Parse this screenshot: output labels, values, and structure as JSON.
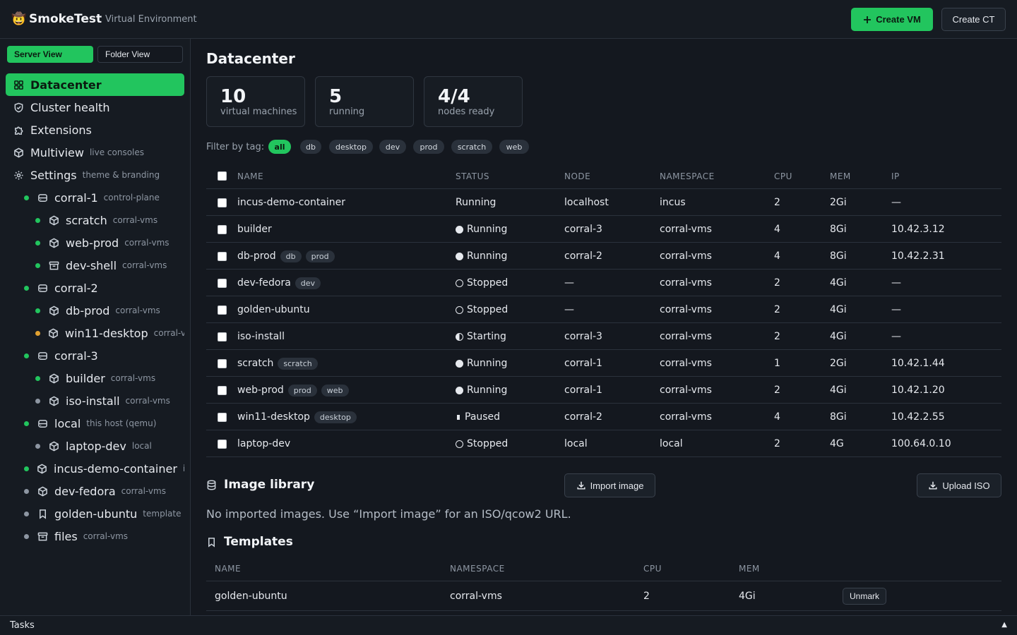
{
  "header": {
    "brand_emoji": "🤠",
    "brand_name": "SmokeTest",
    "brand_sub": "Virtual Environment",
    "create_vm_label": "Create VM",
    "create_ct_label": "Create CT"
  },
  "sidebar": {
    "server_view_label": "Server View",
    "folder_view_label": "Folder View",
    "items": [
      {
        "label": "Datacenter",
        "sub": "",
        "icon": "grid-icon"
      },
      {
        "label": "Cluster health",
        "sub": "",
        "icon": "shield-icon"
      },
      {
        "label": "Extensions",
        "sub": "",
        "icon": "puzzle-icon"
      },
      {
        "label": "Multiview",
        "sub": "live consoles",
        "icon": "cube-icon"
      },
      {
        "label": "Settings",
        "sub": "theme & branding",
        "icon": "gear-icon"
      },
      {
        "label": "corral-1",
        "sub": "control-plane",
        "icon": "server-icon",
        "status": "green"
      },
      {
        "label": "scratch",
        "sub": "corral-vms",
        "icon": "cube-icon",
        "status": "green"
      },
      {
        "label": "web-prod",
        "sub": "corral-vms",
        "icon": "cube-icon",
        "status": "green"
      },
      {
        "label": "dev-shell",
        "sub": "corral-vms",
        "icon": "archive-icon",
        "status": "green"
      },
      {
        "label": "corral-2",
        "sub": "",
        "icon": "server-icon",
        "status": "green"
      },
      {
        "label": "db-prod",
        "sub": "corral-vms",
        "icon": "cube-icon",
        "status": "green"
      },
      {
        "label": "win11-desktop",
        "sub": "corral-vms",
        "icon": "cube-icon",
        "status": "orange"
      },
      {
        "label": "corral-3",
        "sub": "",
        "icon": "server-icon",
        "status": "green"
      },
      {
        "label": "builder",
        "sub": "corral-vms",
        "icon": "cube-icon",
        "status": "green"
      },
      {
        "label": "iso-install",
        "sub": "corral-vms",
        "icon": "cube-icon",
        "status": "gray"
      },
      {
        "label": "local",
        "sub": "this host (qemu)",
        "icon": "server-icon",
        "status": "green"
      },
      {
        "label": "laptop-dev",
        "sub": "local",
        "icon": "cube-icon",
        "status": "gray"
      },
      {
        "label": "incus-demo-container",
        "sub": "incus",
        "icon": "cube-icon",
        "status": "green"
      },
      {
        "label": "dev-fedora",
        "sub": "corral-vms",
        "icon": "cube-icon",
        "status": "gray"
      },
      {
        "label": "golden-ubuntu",
        "sub": "template",
        "icon": "bookmark-icon",
        "status": "gray"
      },
      {
        "label": "files",
        "sub": "corral-vms",
        "icon": "archive-icon",
        "status": "gray"
      }
    ]
  },
  "main": {
    "title": "Datacenter",
    "stats": [
      {
        "value": "10",
        "caption": "virtual machines"
      },
      {
        "value": "5",
        "caption": "running"
      },
      {
        "value": "4/4",
        "caption": "nodes ready"
      }
    ],
    "filter_label": "Filter by tag:",
    "tags": [
      "all",
      "db",
      "desktop",
      "dev",
      "prod",
      "scratch",
      "web"
    ],
    "active_tag": "all",
    "columns": [
      "NAME",
      "STATUS",
      "NODE",
      "NAMESPACE",
      "CPU",
      "MEM",
      "IP"
    ],
    "vms": [
      {
        "name": "incus-demo-container",
        "tags": [],
        "status": "Running",
        "status_icon": "none",
        "node": "localhost",
        "namespace": "incus",
        "cpu": "2",
        "mem": "2Gi",
        "ip": "—"
      },
      {
        "name": "builder",
        "tags": [],
        "status": "Running",
        "status_icon": "running",
        "node": "corral-3",
        "namespace": "corral-vms",
        "cpu": "4",
        "mem": "8Gi",
        "ip": "10.42.3.12"
      },
      {
        "name": "db-prod",
        "tags": [
          "db",
          "prod"
        ],
        "status": "Running",
        "status_icon": "running",
        "node": "corral-2",
        "namespace": "corral-vms",
        "cpu": "4",
        "mem": "8Gi",
        "ip": "10.42.2.31"
      },
      {
        "name": "dev-fedora",
        "tags": [
          "dev"
        ],
        "status": "Stopped",
        "status_icon": "stopped",
        "node": "—",
        "namespace": "corral-vms",
        "cpu": "2",
        "mem": "4Gi",
        "ip": "—"
      },
      {
        "name": "golden-ubuntu",
        "tags": [],
        "status": "Stopped",
        "status_icon": "stopped",
        "node": "—",
        "namespace": "corral-vms",
        "cpu": "2",
        "mem": "4Gi",
        "ip": "—"
      },
      {
        "name": "iso-install",
        "tags": [],
        "status": "Starting",
        "status_icon": "starting",
        "node": "corral-3",
        "namespace": "corral-vms",
        "cpu": "2",
        "mem": "4Gi",
        "ip": "—"
      },
      {
        "name": "scratch",
        "tags": [
          "scratch"
        ],
        "status": "Running",
        "status_icon": "running",
        "node": "corral-1",
        "namespace": "corral-vms",
        "cpu": "1",
        "mem": "2Gi",
        "ip": "10.42.1.44"
      },
      {
        "name": "web-prod",
        "tags": [
          "prod",
          "web"
        ],
        "status": "Running",
        "status_icon": "running",
        "node": "corral-1",
        "namespace": "corral-vms",
        "cpu": "2",
        "mem": "4Gi",
        "ip": "10.42.1.20"
      },
      {
        "name": "win11-desktop",
        "tags": [
          "desktop"
        ],
        "status": "Paused",
        "status_icon": "paused",
        "node": "corral-2",
        "namespace": "corral-vms",
        "cpu": "4",
        "mem": "8Gi",
        "ip": "10.42.2.55"
      },
      {
        "name": "laptop-dev",
        "tags": [],
        "status": "Stopped",
        "status_icon": "stopped",
        "node": "local",
        "namespace": "local",
        "cpu": "2",
        "mem": "4G",
        "ip": "100.64.0.10"
      }
    ],
    "image_library": {
      "title": "Image library",
      "import_label": "Import image",
      "upload_label": "Upload ISO",
      "empty_text": "No imported images. Use “Import image” for an ISO/qcow2 URL."
    },
    "templates": {
      "title": "Templates",
      "columns": [
        "NAME",
        "NAMESPACE",
        "CPU",
        "MEM"
      ],
      "rows": [
        {
          "name": "golden-ubuntu",
          "namespace": "corral-vms",
          "cpu": "2",
          "mem": "4Gi",
          "action": "Unmark"
        }
      ]
    }
  },
  "footer": {
    "tasks_label": "Tasks",
    "toggle": "▲"
  },
  "colors": {
    "accent": "#22c55e",
    "status_orange": "#e0a030",
    "status_gray": "#8d96a2"
  }
}
